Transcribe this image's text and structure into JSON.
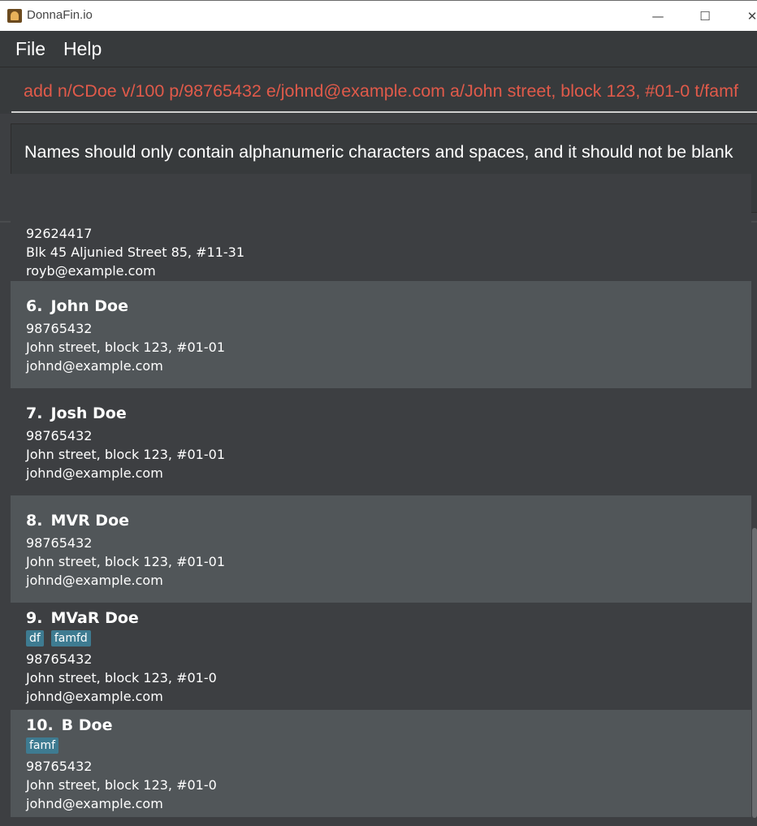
{
  "window": {
    "title": "DonnaFin.io",
    "minimize": "—",
    "maximize": "☐",
    "close": "✕"
  },
  "menu": {
    "file": "File",
    "help": "Help"
  },
  "command_box": {
    "value": "add n/CDoe v/100 p/98765432 e/johnd@example.com a/John street, block 123, #01-0 t/famf"
  },
  "result_display": {
    "message": "Names should only contain alphanumeric characters and spaces, and it should not be blank"
  },
  "clients": [
    {
      "index": "",
      "name": "",
      "tags": [],
      "phone": "92624417",
      "address": "Blk 45 Aljunied Street 85, #11-31",
      "email": "royb@example.com"
    },
    {
      "index": "6.",
      "name": "John Doe",
      "tags": [],
      "phone": "98765432",
      "address": "John street, block 123, #01-01",
      "email": "johnd@example.com"
    },
    {
      "index": "7.",
      "name": "Josh Doe",
      "tags": [],
      "phone": "98765432",
      "address": "John street, block 123, #01-01",
      "email": "johnd@example.com"
    },
    {
      "index": "8.",
      "name": "MVR Doe",
      "tags": [],
      "phone": "98765432",
      "address": "John street, block 123, #01-01",
      "email": "johnd@example.com"
    },
    {
      "index": "9.",
      "name": "MVaR Doe",
      "tags": [
        "df",
        "famfd"
      ],
      "phone": "98765432",
      "address": "John street, block 123, #01-0",
      "email": "johnd@example.com"
    },
    {
      "index": "10.",
      "name": "B Doe",
      "tags": [
        "famf"
      ],
      "phone": "98765432",
      "address": "John street, block 123, #01-0",
      "email": "johnd@example.com"
    }
  ],
  "colors": {
    "error_text": "#e05a4a",
    "tag_bg": "#3e7b91",
    "card_light": "#515659",
    "card_dark": "#3d3f42"
  }
}
